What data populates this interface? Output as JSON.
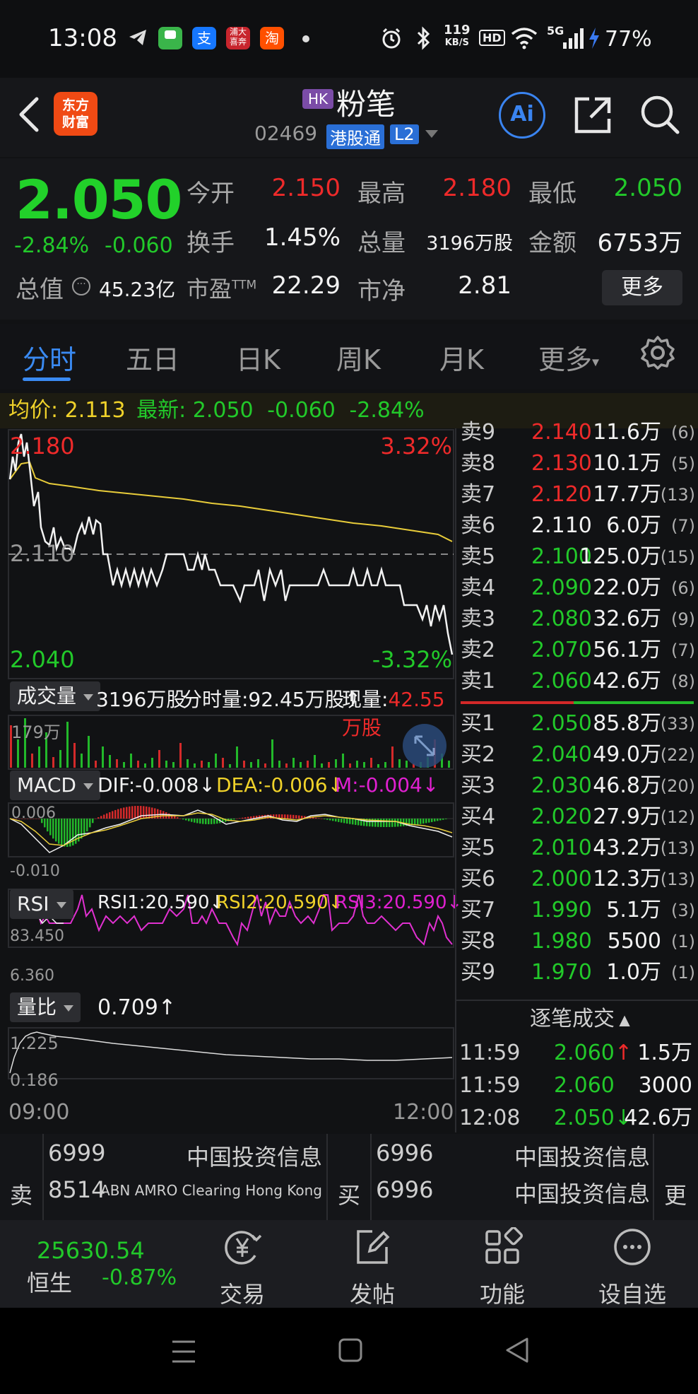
{
  "status_bar": {
    "time": "13:08",
    "net_speed_top": "119",
    "net_speed_unit": "KB/S",
    "hd": "HD",
    "signal": "5G",
    "battery": "77%",
    "app_icons": [
      "telegram-icon",
      "messages-icon",
      "alipay-icon",
      "app-icon",
      "taobao-icon"
    ]
  },
  "header": {
    "logo_line1": "东方",
    "logo_line2": "财富",
    "market_badge": "HK",
    "stock_name": "粉笔",
    "stock_code": "02469",
    "connect_badge": "港股通",
    "level_badge": "L2",
    "ai_label": "Ai"
  },
  "quote": {
    "price": "2.050",
    "change_pct": "-2.84%",
    "change": "-0.060",
    "cap_label": "总值",
    "cap_value": "45.23亿",
    "open_label": "今开",
    "open_value": "2.150",
    "high_label": "最高",
    "high_value": "2.180",
    "low_label": "最低",
    "low_value": "2.050",
    "turnover_label": "换手",
    "turnover_value": "1.45%",
    "volume_label": "总量",
    "volume_value": "3196万股",
    "amount_label": "金额",
    "amount_value": "6753万",
    "pe_label": "市盈",
    "pe_sup": "TTM",
    "pe_value": "22.29",
    "pb_label": "市净",
    "pb_value": "2.81",
    "more_label": "更多"
  },
  "tabs": [
    "分时",
    "五日",
    "日K",
    "周K",
    "月K",
    "更多"
  ],
  "info_bar": {
    "avg_label": "均价:",
    "avg_value": "2.113",
    "latest_label": "最新:",
    "latest_value": "2.050",
    "latest_change": "-0.060",
    "latest_pct": "-2.84%"
  },
  "price_chart": {
    "high_label": "2.180",
    "high_pct": "3.32%",
    "mid_label": "2.110",
    "low_label": "2.040",
    "low_pct": "-3.32%"
  },
  "volume_panel": {
    "label": "成交量",
    "total": "3196万股",
    "time_vol": "分时量:92.45万股",
    "now_label": "现量:",
    "now_value": "42.55万股",
    "max_label": "179万"
  },
  "macd_panel": {
    "label": "MACD",
    "dif": "DIF:-0.008",
    "dea": "DEA:-0.006",
    "m": "M:-0.004",
    "top_label": "0.006",
    "bottom_label": "-0.010"
  },
  "rsi_panel": {
    "label": "RSI",
    "rsi1": "RSI1:20.590",
    "rsi2": "RSI2:20.590",
    "rsi3": "RSI3:20.590",
    "top_label": "83.450",
    "bottom_label": "6.360"
  },
  "ratio_panel": {
    "label": "量比",
    "value": "0.709",
    "top_label": "1.225",
    "bottom_label": "0.186",
    "time_start": "09:00",
    "time_end": "12:00"
  },
  "order_book": {
    "asks": [
      {
        "label": "卖9",
        "price": "2.140",
        "vol": "11.6万",
        "count": "(6)"
      },
      {
        "label": "卖8",
        "price": "2.130",
        "vol": "10.1万",
        "count": "(5)"
      },
      {
        "label": "卖7",
        "price": "2.120",
        "vol": "17.7万",
        "count": "(13)"
      },
      {
        "label": "卖6",
        "price": "2.110",
        "vol": "6.0万",
        "count": "(7)"
      },
      {
        "label": "卖5",
        "price": "2.100",
        "vol": "125.0万",
        "count": "(15)"
      },
      {
        "label": "卖4",
        "price": "2.090",
        "vol": "22.0万",
        "count": "(6)"
      },
      {
        "label": "卖3",
        "price": "2.080",
        "vol": "32.6万",
        "count": "(9)"
      },
      {
        "label": "卖2",
        "price": "2.070",
        "vol": "56.1万",
        "count": "(7)"
      },
      {
        "label": "卖1",
        "price": "2.060",
        "vol": "42.6万",
        "count": "(8)"
      }
    ],
    "bids": [
      {
        "label": "买1",
        "price": "2.050",
        "vol": "85.8万",
        "count": "(33)"
      },
      {
        "label": "买2",
        "price": "2.040",
        "vol": "49.0万",
        "count": "(22)"
      },
      {
        "label": "买3",
        "price": "2.030",
        "vol": "46.8万",
        "count": "(20)"
      },
      {
        "label": "买4",
        "price": "2.020",
        "vol": "27.9万",
        "count": "(12)"
      },
      {
        "label": "买5",
        "price": "2.010",
        "vol": "43.2万",
        "count": "(13)"
      },
      {
        "label": "买6",
        "price": "2.000",
        "vol": "12.3万",
        "count": "(13)"
      },
      {
        "label": "买7",
        "price": "1.990",
        "vol": "5.1万",
        "count": "(3)"
      },
      {
        "label": "买8",
        "price": "1.980",
        "vol": "5500",
        "count": "(1)"
      },
      {
        "label": "买9",
        "price": "1.970",
        "vol": "1.0万",
        "count": "(1)"
      }
    ],
    "ticks_title": "逐笔成交",
    "ticks": [
      {
        "time": "11:59",
        "price": "2.060",
        "arrow": "↑",
        "vol": "1.5万"
      },
      {
        "time": "11:59",
        "price": "2.060",
        "arrow": "",
        "vol": "3000"
      },
      {
        "time": "12:08",
        "price": "2.050",
        "arrow": "↓",
        "vol": "42.6万"
      }
    ]
  },
  "brokers": {
    "sell_label": "卖",
    "buy_label": "买",
    "more_label": "更",
    "sell": [
      {
        "id": "6999",
        "name": "中国投资信息"
      },
      {
        "id": "8514",
        "name": "ABN AMRO Clearing Hong Kong"
      }
    ],
    "buy": [
      {
        "id": "6996",
        "name": "中国投资信息"
      },
      {
        "id": "6996",
        "name": "中国投资信息"
      }
    ]
  },
  "bottom_nav": {
    "index_value": "25630.54",
    "index_name": "恒生",
    "index_change": "-0.87%",
    "items": [
      {
        "label": "交易",
        "icon": "yen-trade-icon"
      },
      {
        "label": "发帖",
        "icon": "edit-post-icon"
      },
      {
        "label": "功能",
        "icon": "grid-icon"
      },
      {
        "label": "设自选",
        "icon": "more-dots-icon"
      }
    ]
  },
  "colors": {
    "up": "#ee2a2a",
    "down": "#22c92a",
    "accent": "#3a8af2",
    "avg_line": "#f0d22a"
  }
}
